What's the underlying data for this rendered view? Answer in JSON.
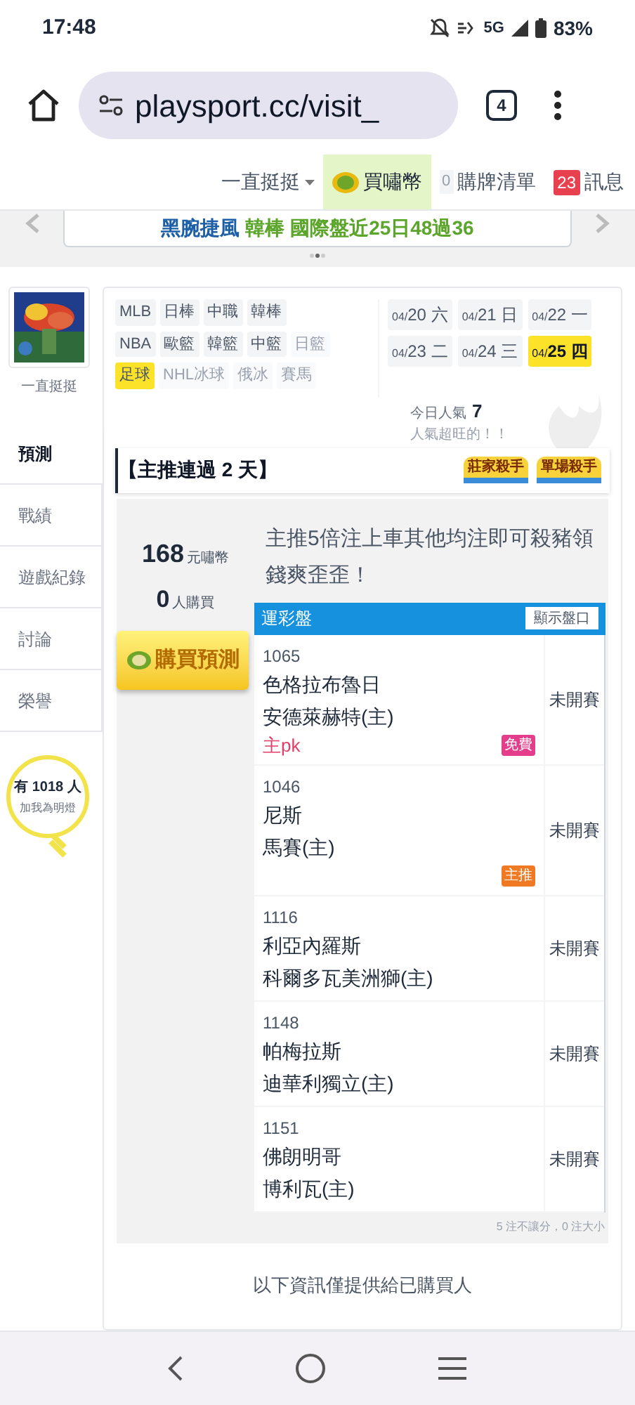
{
  "status_bar": {
    "time": "17:48",
    "network": "5G",
    "battery": "83%"
  },
  "browser": {
    "url": "playsport.cc/visit_",
    "tab_count": "4"
  },
  "nav": [
    {
      "kind": "dropdown",
      "label": "一直挺挺",
      "selected": false
    },
    {
      "kind": "coin",
      "label": "買嘯幣",
      "selected": true
    },
    {
      "kind": "count",
      "count": "0",
      "label": "購牌清單",
      "selected": false
    },
    {
      "kind": "badge",
      "count": "23",
      "label": "訊息",
      "selected": false
    }
  ],
  "banner": {
    "segments": [
      {
        "text": "黑腕捷風",
        "color": "#1d5fa6"
      },
      {
        "text": "韓棒 國際盤近25日48過36",
        "color": "#5aa52a"
      }
    ]
  },
  "user": {
    "name": "一直挺挺"
  },
  "sidebar": {
    "items": [
      {
        "label": "預測",
        "selected": true
      },
      {
        "label": "戰績",
        "selected": false
      },
      {
        "label": "遊戲紀錄",
        "selected": false
      },
      {
        "label": "討論",
        "selected": false
      },
      {
        "label": "榮譽",
        "selected": false
      }
    ]
  },
  "fans": {
    "prefix": "有",
    "count": "1018",
    "suffix": "人",
    "caption": "加我為明燈"
  },
  "sports_rows": [
    {
      "tags": [
        {
          "label": "MLB",
          "selected": false,
          "disabled": false
        },
        {
          "label": "日棒",
          "selected": false,
          "disabled": false
        },
        {
          "label": "中職",
          "selected": false,
          "disabled": false
        },
        {
          "label": "韓棒",
          "selected": false,
          "disabled": false
        }
      ]
    },
    {
      "tags": [
        {
          "label": "NBA",
          "selected": false,
          "disabled": false
        },
        {
          "label": "歐籃",
          "selected": false,
          "disabled": false
        },
        {
          "label": "韓籃",
          "selected": false,
          "disabled": false
        },
        {
          "label": "中籃",
          "selected": false,
          "disabled": false
        },
        {
          "label": "日籃",
          "selected": false,
          "disabled": true
        }
      ]
    },
    {
      "tags": [
        {
          "label": "足球",
          "selected": true,
          "disabled": false
        },
        {
          "label": "NHL冰球",
          "selected": false,
          "disabled": true
        },
        {
          "label": "俄冰",
          "selected": false,
          "disabled": true
        },
        {
          "label": "賽馬",
          "selected": false,
          "disabled": true
        }
      ]
    }
  ],
  "dates": [
    {
      "month": "04/",
      "day": "20 六",
      "selected": false
    },
    {
      "month": "04/",
      "day": "21 日",
      "selected": false
    },
    {
      "month": "04/",
      "day": "22 一",
      "selected": false
    },
    {
      "month": "04/",
      "day": "23 二",
      "selected": false
    },
    {
      "month": "04/",
      "day": "24 三",
      "selected": false
    },
    {
      "month": "04/",
      "day": "25 四",
      "selected": true
    }
  ],
  "popularity": {
    "label": "今日人氣",
    "value": "7",
    "note": "人氣超旺的！！"
  },
  "headline": "【主推連過 2 天】",
  "badges": [
    "莊家殺手",
    "單場殺手"
  ],
  "purchase": {
    "price": "168",
    "price_unit": "元嘯幣",
    "buyers": "0",
    "buyers_unit": "人購買",
    "button": "購買預測"
  },
  "description": "主推5倍注上車其他均注即可殺豬領錢爽歪歪！",
  "table": {
    "title": "運彩盤",
    "toggle": "顯示盤口",
    "games": [
      {
        "id": "1065",
        "teams": [
          "色格拉布魯日",
          "安德萊赫特(主)"
        ],
        "pick": "主pk",
        "tag": {
          "kind": "free",
          "label": "免費"
        },
        "status": "未開賽"
      },
      {
        "id": "1046",
        "teams": [
          "尼斯",
          "馬賽(主)"
        ],
        "tag": {
          "kind": "main",
          "label": "主推"
        },
        "status": "未開賽"
      },
      {
        "id": "1116",
        "teams": [
          "利亞內羅斯",
          "科爾多瓦美洲獅(主)"
        ],
        "status": "未開賽"
      },
      {
        "id": "1148",
        "teams": [
          "帕梅拉斯",
          "迪華利獨立(主)"
        ],
        "status": "未開賽"
      },
      {
        "id": "1151",
        "teams": [
          "佛朗明哥",
          "博利瓦(主)"
        ],
        "status": "未開賽"
      }
    ],
    "footnote": "5 注不讓分，0 注大小"
  },
  "notice": "以下資訊僅提供給已購買人"
}
